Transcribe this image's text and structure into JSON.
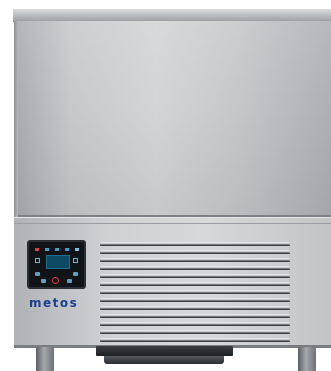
{
  "product": {
    "brand_label": "metos"
  },
  "colors": {
    "brand_text": "#1c3f8f",
    "panel_steel": "#cfd1d3",
    "display_background": "#111416",
    "power_indicator": "#d93b3b"
  },
  "icons": {
    "control_panel": "touch-display-icon",
    "power": "power-icon"
  }
}
